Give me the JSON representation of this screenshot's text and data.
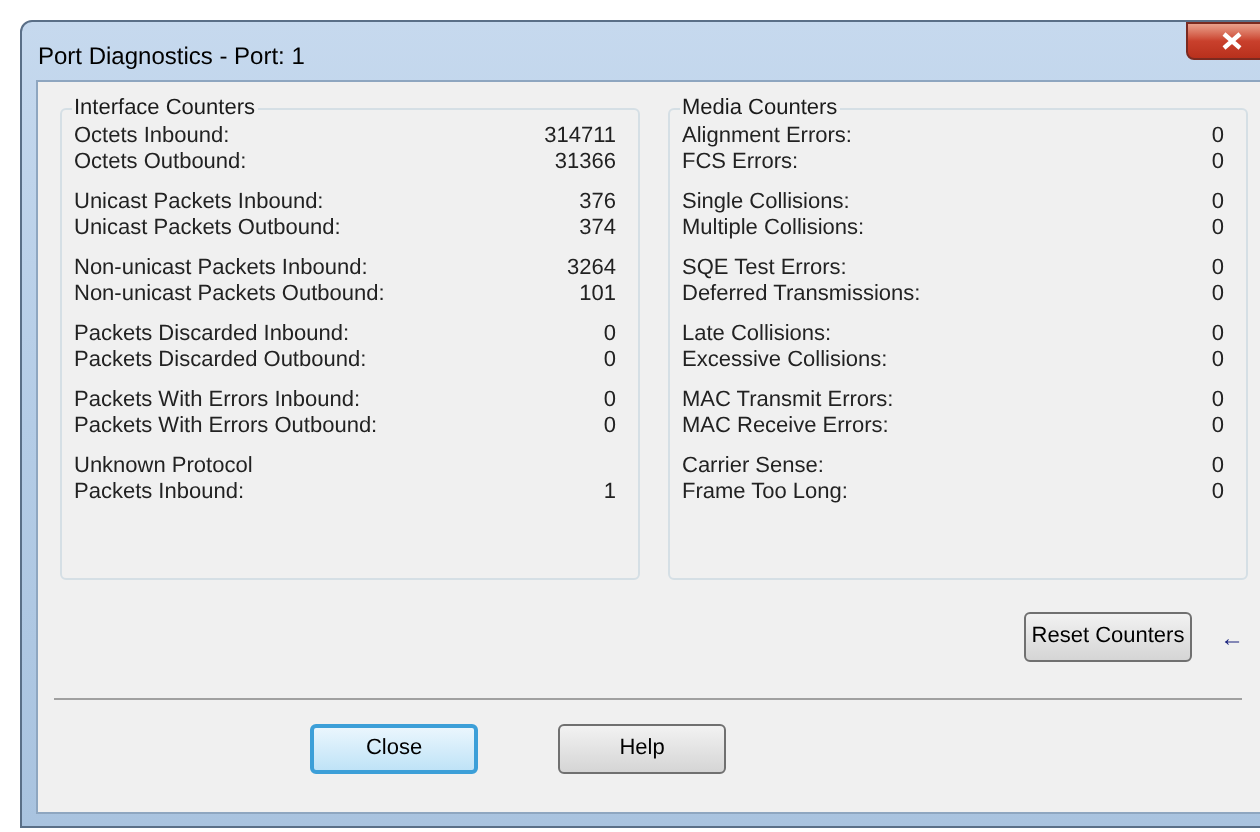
{
  "window": {
    "title": "Port Diagnostics -  Port: 1"
  },
  "panels": [
    {
      "title": "Interface Counters",
      "groups": [
        [
          {
            "label": "Octets Inbound:",
            "value": "314711"
          },
          {
            "label": "Octets Outbound:",
            "value": "31366"
          }
        ],
        [
          {
            "label": "Unicast Packets Inbound:",
            "value": "376"
          },
          {
            "label": "Unicast Packets Outbound:",
            "value": "374"
          }
        ],
        [
          {
            "label": "Non-unicast Packets Inbound:",
            "value": "3264"
          },
          {
            "label": "Non-unicast Packets Outbound:",
            "value": "101"
          }
        ],
        [
          {
            "label": "Packets Discarded Inbound:",
            "value": "0"
          },
          {
            "label": "Packets Discarded Outbound:",
            "value": "0"
          }
        ],
        [
          {
            "label": "Packets With Errors Inbound:",
            "value": "0"
          },
          {
            "label": "Packets With Errors Outbound:",
            "value": "0"
          }
        ],
        [
          {
            "label": "Unknown Protocol"
          },
          {
            "label": "Packets Inbound:",
            "value": "1"
          }
        ]
      ]
    },
    {
      "title": "Media Counters",
      "groups": [
        [
          {
            "label": "Alignment Errors:",
            "value": "0"
          },
          {
            "label": "FCS Errors:",
            "value": "0"
          }
        ],
        [
          {
            "label": "Single Collisions:",
            "value": "0"
          },
          {
            "label": "Multiple Collisions:",
            "value": "0"
          }
        ],
        [
          {
            "label": "SQE Test Errors:",
            "value": "0"
          },
          {
            "label": "Deferred Transmissions:",
            "value": "0"
          }
        ],
        [
          {
            "label": "Late Collisions:",
            "value": "0"
          },
          {
            "label": "Excessive Collisions:",
            "value": "0"
          }
        ],
        [
          {
            "label": "MAC Transmit Errors:",
            "value": "0"
          },
          {
            "label": "MAC Receive Errors:",
            "value": "0"
          }
        ],
        [
          {
            "label": "Carrier Sense:",
            "value": "0"
          },
          {
            "label": "Frame Too Long:",
            "value": "0"
          }
        ]
      ]
    }
  ],
  "reset_button": {
    "label": "Reset Counters",
    "arrow": "←"
  },
  "buttons": [
    {
      "label": "Close",
      "focused": true
    },
    {
      "label": "Help",
      "focused": false
    }
  ]
}
